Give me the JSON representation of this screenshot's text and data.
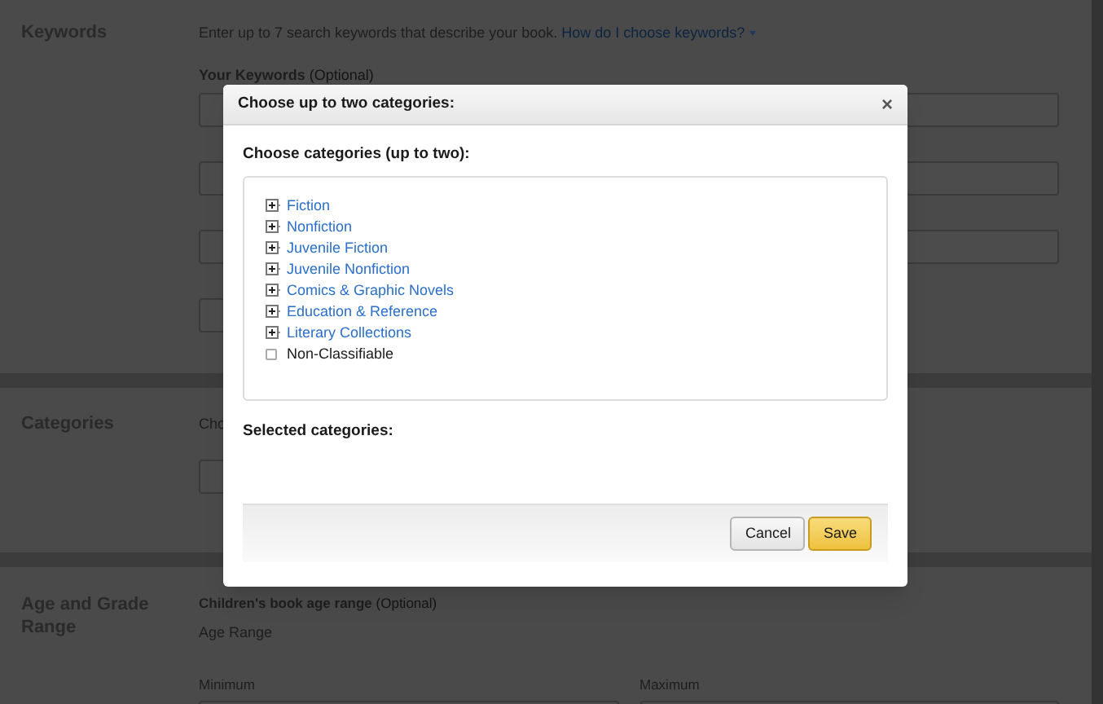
{
  "page": {
    "keywords": {
      "title": "Keywords",
      "intro": "Enter up to 7 search keywords that describe your book.",
      "help_link": "How do I choose keywords?",
      "label": "Your Keywords",
      "label_note": "(Optional)"
    },
    "categories": {
      "title": "Categories",
      "intro": "Cho"
    },
    "age": {
      "title": "Age and Grade Range",
      "label": "Children's book age range",
      "label_note": "(Optional)",
      "sublabel": "Age Range",
      "min_label": "Minimum",
      "max_label": "Maximum"
    }
  },
  "dialog": {
    "title": "Choose up to two categories:",
    "close": "×",
    "prompt": "Choose categories (up to two):",
    "items": [
      {
        "kind": "branch",
        "label": "Fiction",
        "expanded": false
      },
      {
        "kind": "branch",
        "label": "Nonfiction",
        "expanded": false
      },
      {
        "kind": "branch",
        "label": "Juvenile Fiction",
        "expanded": false
      },
      {
        "kind": "branch",
        "label": "Juvenile Nonfiction",
        "expanded": false
      },
      {
        "kind": "branch",
        "label": "Comics & Graphic Novels",
        "expanded": false
      },
      {
        "kind": "branch",
        "label": "Education & Reference",
        "expanded": false
      },
      {
        "kind": "branch",
        "label": "Literary Collections",
        "expanded": false
      },
      {
        "kind": "checkbox",
        "label": "Non-Classifiable",
        "checked": false
      }
    ],
    "selected_heading": "Selected categories:",
    "buttons": [
      {
        "kind": "secondary",
        "label": "Cancel"
      },
      {
        "kind": "primary",
        "label": "Save"
      }
    ]
  }
}
